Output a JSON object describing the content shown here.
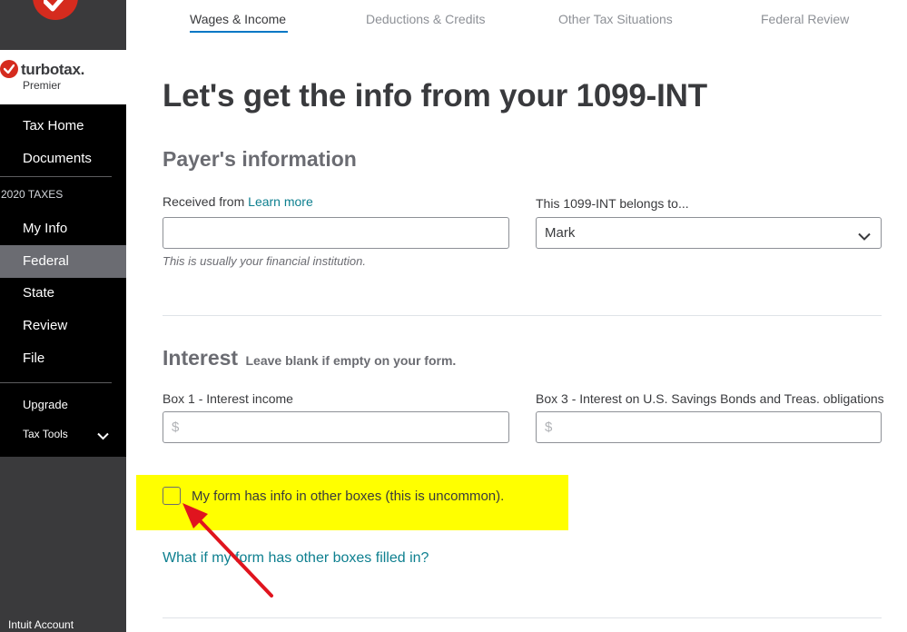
{
  "colors": {
    "sidebar_bg": "#000000",
    "sidebar_active": "#6b6c72",
    "brand_red": "#d52b1e",
    "accent_blue": "#0077c5",
    "link_teal": "#0d7f8f",
    "highlight_yellow": "#ffff00",
    "arrow_red": "#e0141e"
  },
  "sidebar": {
    "brand_name": "turbotax.",
    "brand_edition": "Premier",
    "top_items": [
      {
        "label": "Tax Home"
      },
      {
        "label": "Documents"
      }
    ],
    "section_label": "2020 TAXES",
    "tax_items": [
      {
        "label": "My Info"
      },
      {
        "label": "Federal",
        "active": true
      },
      {
        "label": "State"
      },
      {
        "label": "Review"
      },
      {
        "label": "File"
      }
    ],
    "upgrade_label": "Upgrade",
    "tax_tools_label": "Tax Tools",
    "account_label": "Intuit Account"
  },
  "tabs": [
    {
      "label": "Wages & Income",
      "active": true
    },
    {
      "label": "Deductions & Credits"
    },
    {
      "label": "Other Tax Situations"
    },
    {
      "label": "Federal Review"
    }
  ],
  "main": {
    "title": "Let's get the info from your 1099-INT",
    "payer_section": {
      "title": "Payer's information",
      "received_from_label": "Received from",
      "learn_more_label": "Learn more",
      "received_from_value": "",
      "received_from_helper": "This is usually your financial institution.",
      "belongs_to_label": "This 1099-INT belongs to...",
      "belongs_to_value": "Mark"
    },
    "interest_section": {
      "title": "Interest",
      "note": "Leave blank if empty on your form.",
      "box1_label": "Box 1 - Interest income",
      "box1_placeholder": "$",
      "box3_label": "Box 3 - Interest on U.S. Savings Bonds and Treas. obligations",
      "box3_placeholder": "$"
    },
    "other_boxes_checkbox": {
      "label": "My form has info in other boxes (this is uncommon).",
      "checked": false
    },
    "help_link": "What if my form has other boxes filled in?"
  },
  "icons": {
    "check_logo": "checkmark-circle-icon",
    "select_chevron": "chevron-down-icon",
    "tax_tools_chevron": "chevron-down-icon",
    "annotation": "red-arrow-icon"
  }
}
